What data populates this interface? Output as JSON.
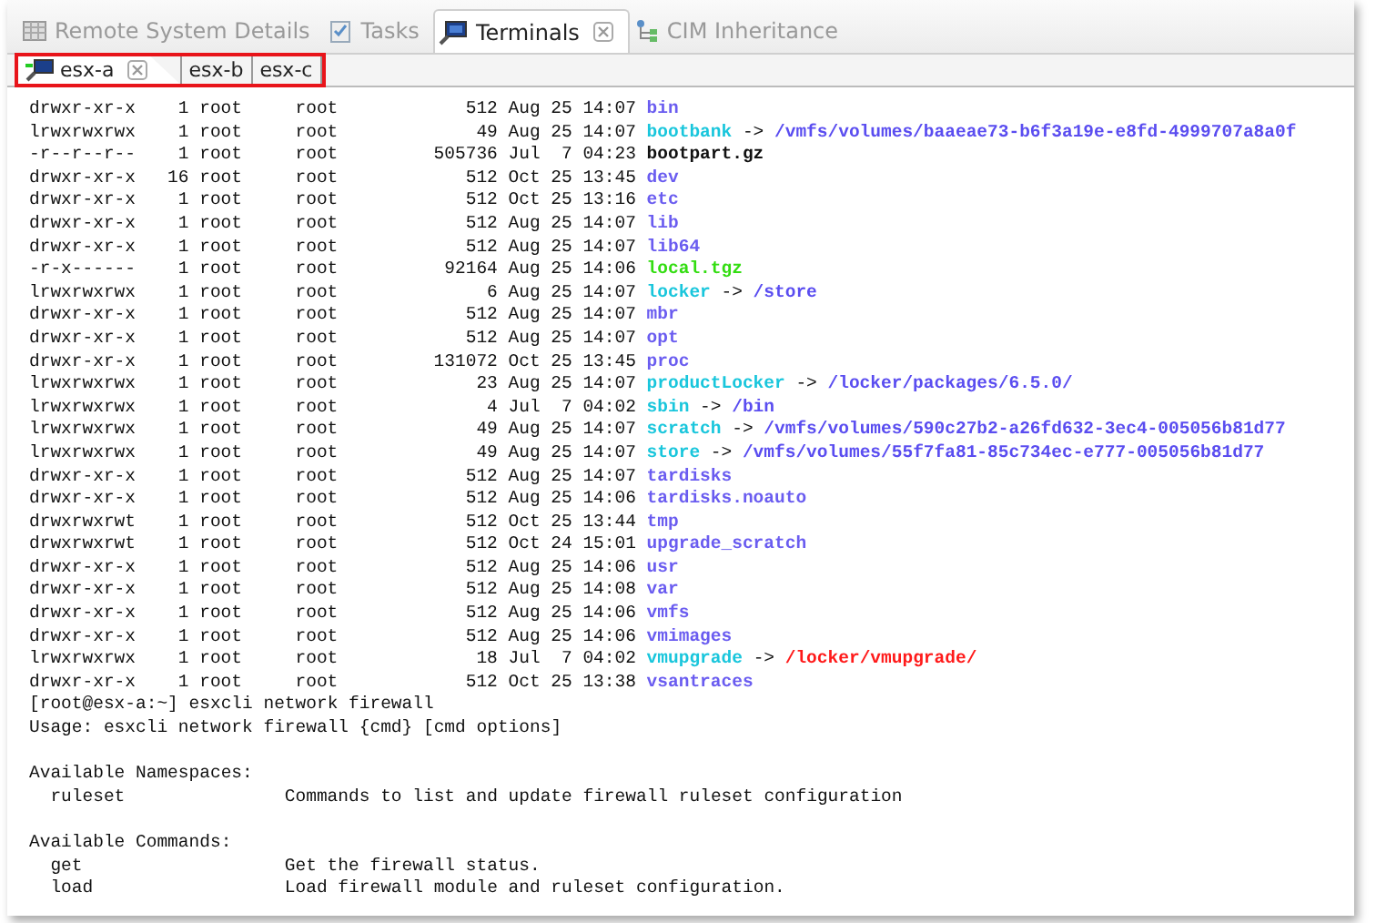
{
  "view_tabs": [
    {
      "label": "Remote System Details",
      "selected": false,
      "closable": false
    },
    {
      "label": "Tasks",
      "selected": false,
      "closable": false
    },
    {
      "label": "Terminals",
      "selected": true,
      "closable": true
    },
    {
      "label": "CIM Inheritance",
      "selected": false,
      "closable": false
    }
  ],
  "session_tabs": [
    {
      "label": "esx-a",
      "selected": true,
      "closable": true
    },
    {
      "label": "esx-b",
      "selected": false,
      "closable": false
    },
    {
      "label": "esx-c",
      "selected": false,
      "closable": false
    }
  ],
  "listing": [
    {
      "perms": "drwxr-xr-x",
      "links": "1",
      "owner": "root",
      "group": "root",
      "size": "512",
      "date": "Aug 25 14:07",
      "name": "bin",
      "kind": "dir"
    },
    {
      "perms": "lrwxrwxrwx",
      "links": "1",
      "owner": "root",
      "group": "root",
      "size": "49",
      "date": "Aug 25 14:07",
      "name": "bootbank",
      "kind": "link",
      "arrow": "->",
      "target": "/vmfs/volumes/baaeae73-b6f3a19e-e8fd-4999707a8a0f",
      "broken": false
    },
    {
      "perms": "-r--r--r--",
      "links": "1",
      "owner": "root",
      "group": "root",
      "size": "505736",
      "date": "Jul  7 04:23",
      "name": "bootpart.gz",
      "kind": "file"
    },
    {
      "perms": "drwxr-xr-x",
      "links": "16",
      "owner": "root",
      "group": "root",
      "size": "512",
      "date": "Oct 25 13:45",
      "name": "dev",
      "kind": "dir"
    },
    {
      "perms": "drwxr-xr-x",
      "links": "1",
      "owner": "root",
      "group": "root",
      "size": "512",
      "date": "Oct 25 13:16",
      "name": "etc",
      "kind": "dir"
    },
    {
      "perms": "drwxr-xr-x",
      "links": "1",
      "owner": "root",
      "group": "root",
      "size": "512",
      "date": "Aug 25 14:07",
      "name": "lib",
      "kind": "dir"
    },
    {
      "perms": "drwxr-xr-x",
      "links": "1",
      "owner": "root",
      "group": "root",
      "size": "512",
      "date": "Aug 25 14:07",
      "name": "lib64",
      "kind": "dir"
    },
    {
      "perms": "-r-x------",
      "links": "1",
      "owner": "root",
      "group": "root",
      "size": "92164",
      "date": "Aug 25 14:06",
      "name": "local.tgz",
      "kind": "archive"
    },
    {
      "perms": "lrwxrwxrwx",
      "links": "1",
      "owner": "root",
      "group": "root",
      "size": "6",
      "date": "Aug 25 14:07",
      "name": "locker",
      "kind": "link",
      "arrow": "->",
      "target": "/store",
      "broken": false
    },
    {
      "perms": "drwxr-xr-x",
      "links": "1",
      "owner": "root",
      "group": "root",
      "size": "512",
      "date": "Aug 25 14:07",
      "name": "mbr",
      "kind": "dir"
    },
    {
      "perms": "drwxr-xr-x",
      "links": "1",
      "owner": "root",
      "group": "root",
      "size": "512",
      "date": "Aug 25 14:07",
      "name": "opt",
      "kind": "dir"
    },
    {
      "perms": "drwxr-xr-x",
      "links": "1",
      "owner": "root",
      "group": "root",
      "size": "131072",
      "date": "Oct 25 13:45",
      "name": "proc",
      "kind": "dir"
    },
    {
      "perms": "lrwxrwxrwx",
      "links": "1",
      "owner": "root",
      "group": "root",
      "size": "23",
      "date": "Aug 25 14:07",
      "name": "productLocker",
      "kind": "link",
      "arrow": "->",
      "target": "/locker/packages/6.5.0/",
      "broken": false
    },
    {
      "perms": "lrwxrwxrwx",
      "links": "1",
      "owner": "root",
      "group": "root",
      "size": "4",
      "date": "Jul  7 04:02",
      "name": "sbin",
      "kind": "link",
      "arrow": "->",
      "target": "/bin",
      "broken": false
    },
    {
      "perms": "lrwxrwxrwx",
      "links": "1",
      "owner": "root",
      "group": "root",
      "size": "49",
      "date": "Aug 25 14:07",
      "name": "scratch",
      "kind": "link",
      "arrow": "->",
      "target": "/vmfs/volumes/590c27b2-a26fd632-3ec4-005056b81d77",
      "broken": false
    },
    {
      "perms": "lrwxrwxrwx",
      "links": "1",
      "owner": "root",
      "group": "root",
      "size": "49",
      "date": "Aug 25 14:07",
      "name": "store",
      "kind": "link",
      "arrow": "->",
      "target": "/vmfs/volumes/55f7fa81-85c734ec-e777-005056b81d77",
      "broken": false
    },
    {
      "perms": "drwxr-xr-x",
      "links": "1",
      "owner": "root",
      "group": "root",
      "size": "512",
      "date": "Aug 25 14:07",
      "name": "tardisks",
      "kind": "dir"
    },
    {
      "perms": "drwxr-xr-x",
      "links": "1",
      "owner": "root",
      "group": "root",
      "size": "512",
      "date": "Aug 25 14:06",
      "name": "tardisks.noauto",
      "kind": "dir"
    },
    {
      "perms": "drwxrwxrwt",
      "links": "1",
      "owner": "root",
      "group": "root",
      "size": "512",
      "date": "Oct 25 13:44",
      "name": "tmp",
      "kind": "dir"
    },
    {
      "perms": "drwxrwxrwt",
      "links": "1",
      "owner": "root",
      "group": "root",
      "size": "512",
      "date": "Oct 24 15:01",
      "name": "upgrade_scratch",
      "kind": "dir"
    },
    {
      "perms": "drwxr-xr-x",
      "links": "1",
      "owner": "root",
      "group": "root",
      "size": "512",
      "date": "Aug 25 14:06",
      "name": "usr",
      "kind": "dir"
    },
    {
      "perms": "drwxr-xr-x",
      "links": "1",
      "owner": "root",
      "group": "root",
      "size": "512",
      "date": "Aug 25 14:08",
      "name": "var",
      "kind": "dir"
    },
    {
      "perms": "drwxr-xr-x",
      "links": "1",
      "owner": "root",
      "group": "root",
      "size": "512",
      "date": "Aug 25 14:06",
      "name": "vmfs",
      "kind": "dir"
    },
    {
      "perms": "drwxr-xr-x",
      "links": "1",
      "owner": "root",
      "group": "root",
      "size": "512",
      "date": "Aug 25 14:06",
      "name": "vmimages",
      "kind": "dir"
    },
    {
      "perms": "lrwxrwxrwx",
      "links": "1",
      "owner": "root",
      "group": "root",
      "size": "18",
      "date": "Jul  7 04:02",
      "name": "vmupgrade",
      "kind": "link",
      "arrow": "->",
      "target": "/locker/vmupgrade/",
      "broken": true
    },
    {
      "perms": "drwxr-xr-x",
      "links": "1",
      "owner": "root",
      "group": "root",
      "size": "512",
      "date": "Oct 25 13:38",
      "name": "vsantraces",
      "kind": "dir"
    }
  ],
  "output": [
    {
      "kind": "line",
      "text": "[root@esx-a:~] esxcli network firewall"
    },
    {
      "kind": "line",
      "text": "Usage: esxcli network firewall {cmd} [cmd options]"
    },
    {
      "kind": "blank"
    },
    {
      "kind": "line",
      "text": "Available Namespaces:"
    },
    {
      "kind": "entry",
      "name": "ruleset",
      "description": "Commands to list and update firewall ruleset configuration"
    },
    {
      "kind": "blank"
    },
    {
      "kind": "line",
      "text": "Available Commands:"
    },
    {
      "kind": "entry",
      "name": "get",
      "description": "Get the firewall status."
    },
    {
      "kind": "entry",
      "name": "load",
      "description": "Load firewall module and ruleset configuration."
    }
  ]
}
